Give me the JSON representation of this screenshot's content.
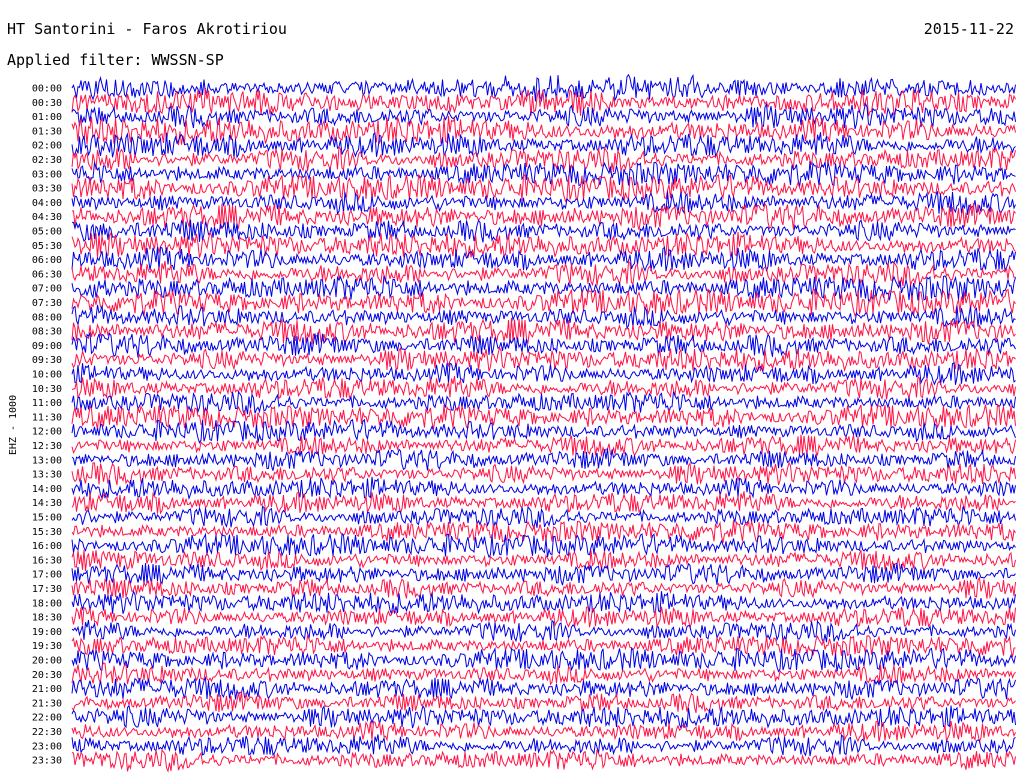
{
  "header": {
    "station": "HT Santorini - Faros Akrotiriou",
    "date": "2015-11-22",
    "filter_text": "Applied filter: WWSSN-SP"
  },
  "chart_data": {
    "type": "line",
    "channel_label": "EHZ - 1000",
    "colors": [
      "#0000e6",
      "#ff1446"
    ],
    "rows": [
      {
        "time": "00:00",
        "amp": 0.55
      },
      {
        "time": "00:30",
        "amp": 0.6
      },
      {
        "time": "01:00",
        "amp": 0.55
      },
      {
        "time": "01:30",
        "amp": 0.65
      },
      {
        "time": "02:00",
        "amp": 0.55
      },
      {
        "time": "02:30",
        "amp": 0.55
      },
      {
        "time": "03:00",
        "amp": 0.55
      },
      {
        "time": "03:30",
        "amp": 0.55
      },
      {
        "time": "04:00",
        "amp": 0.55
      },
      {
        "time": "04:30",
        "amp": 0.6
      },
      {
        "time": "05:00",
        "amp": 0.55
      },
      {
        "time": "05:30",
        "amp": 0.55
      },
      {
        "time": "06:00",
        "amp": 0.55
      },
      {
        "time": "06:30",
        "amp": 0.55
      },
      {
        "time": "07:00",
        "amp": 0.6
      },
      {
        "time": "07:30",
        "amp": 0.55
      },
      {
        "time": "08:00",
        "amp": 0.55
      },
      {
        "time": "08:30",
        "amp": 0.6
      },
      {
        "time": "09:00",
        "amp": 0.55
      },
      {
        "time": "09:30",
        "amp": 0.5
      },
      {
        "time": "10:00",
        "amp": 0.5
      },
      {
        "time": "10:30",
        "amp": 0.5
      },
      {
        "time": "11:00",
        "amp": 0.5
      },
      {
        "time": "11:30",
        "amp": 0.5
      },
      {
        "time": "12:00",
        "amp": 0.45
      },
      {
        "time": "12:30",
        "amp": 0.45
      },
      {
        "time": "13:00",
        "amp": 0.45
      },
      {
        "time": "13:30",
        "amp": 0.45
      },
      {
        "time": "14:00",
        "amp": 0.45
      },
      {
        "time": "14:30",
        "amp": 0.45
      },
      {
        "time": "15:00",
        "amp": 0.45
      },
      {
        "time": "15:30",
        "amp": 0.45
      },
      {
        "time": "16:00",
        "amp": 0.45
      },
      {
        "time": "16:30",
        "amp": 0.45
      },
      {
        "time": "17:00",
        "amp": 0.45
      },
      {
        "time": "17:30",
        "amp": 0.45
      },
      {
        "time": "18:00",
        "amp": 0.45
      },
      {
        "time": "18:30",
        "amp": 0.45
      },
      {
        "time": "19:00",
        "amp": 0.45
      },
      {
        "time": "19:30",
        "amp": 0.45
      },
      {
        "time": "20:00",
        "amp": 0.45
      },
      {
        "time": "20:30",
        "amp": 0.45
      },
      {
        "time": "21:00",
        "amp": 0.45
      },
      {
        "time": "21:30",
        "amp": 0.45
      },
      {
        "time": "22:00",
        "amp": 0.45
      },
      {
        "time": "22:30",
        "amp": 0.45
      },
      {
        "time": "23:00",
        "amp": 0.45
      },
      {
        "time": "23:30",
        "amp": 0.45
      }
    ]
  }
}
